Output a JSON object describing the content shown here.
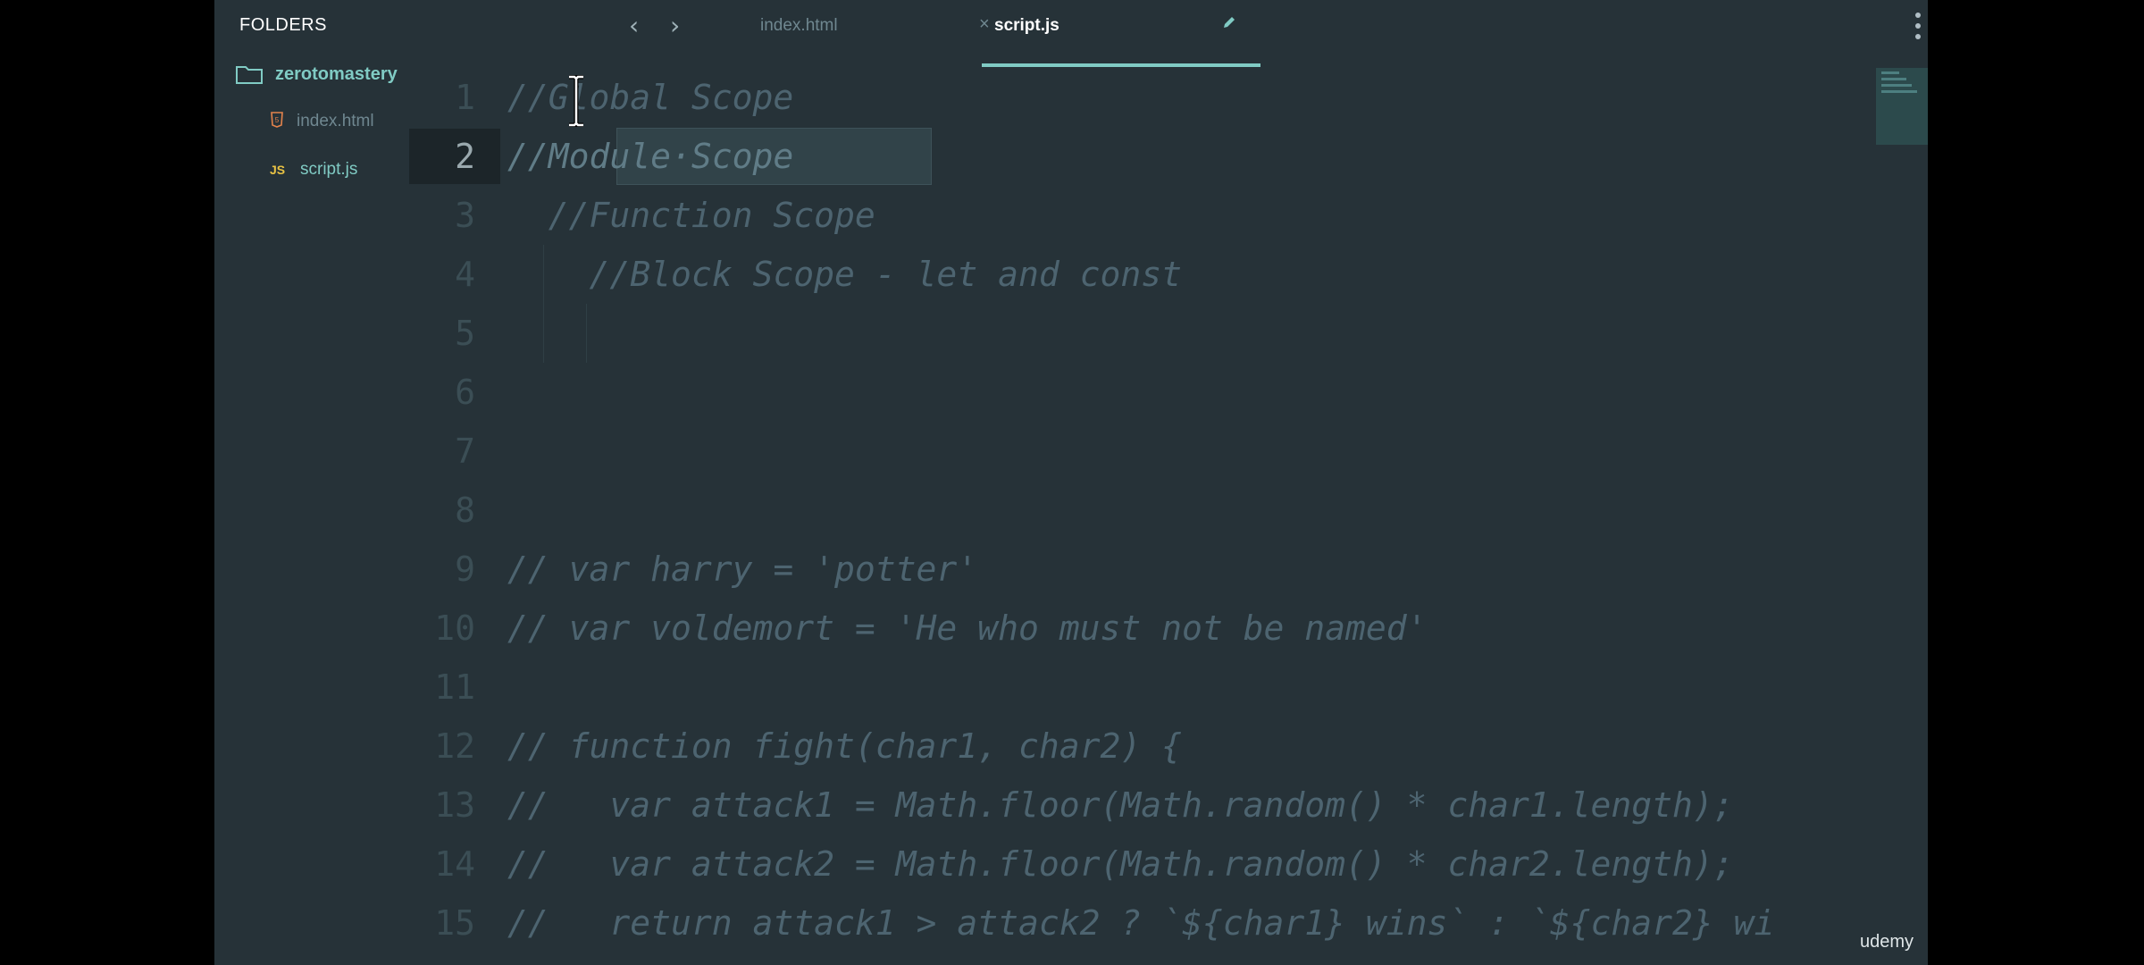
{
  "sidebar": {
    "header": "FOLDERS",
    "folder": {
      "name": "zerotomastery",
      "icon": "folder-icon"
    },
    "files": [
      {
        "name": "index.html",
        "icon": "html-file-icon",
        "badge": "5"
      },
      {
        "name": "script.js",
        "icon": "js-file-icon",
        "badge": "JS"
      }
    ]
  },
  "tabs": [
    {
      "label": "index.html",
      "close_glyph": "×"
    },
    {
      "label": "script.js",
      "edit_icon": "pencil-icon"
    }
  ],
  "nav": {
    "back_glyph": "‹",
    "forward_glyph": "›"
  },
  "editor": {
    "active_line": 2,
    "lines": [
      {
        "n": "1",
        "text": "//Global Scope"
      },
      {
        "n": "2",
        "text": "//Module·Scope"
      },
      {
        "n": "3",
        "text": "  //Function Scope"
      },
      {
        "n": "4",
        "text": "    //Block Scope - let and const"
      },
      {
        "n": "5",
        "text": ""
      },
      {
        "n": "6",
        "text": ""
      },
      {
        "n": "7",
        "text": ""
      },
      {
        "n": "8",
        "text": ""
      },
      {
        "n": "9",
        "text": "// var harry = 'potter'"
      },
      {
        "n": "10",
        "text": "// var voldemort = 'He who must not be named'"
      },
      {
        "n": "11",
        "text": ""
      },
      {
        "n": "12",
        "text": "// function fight(char1, char2) {"
      },
      {
        "n": "13",
        "text": "//   var attack1 = Math.floor(Math.random() * char1.length);"
      },
      {
        "n": "14",
        "text": "//   var attack2 = Math.floor(Math.random() * char2.length);"
      },
      {
        "n": "15",
        "text": "//   return attack1 > attack2 ? `${char1} wins` : `${char2} wi"
      }
    ]
  },
  "watermark": "udemy",
  "colors": {
    "accent": "#80cbc4",
    "background": "#263238"
  }
}
